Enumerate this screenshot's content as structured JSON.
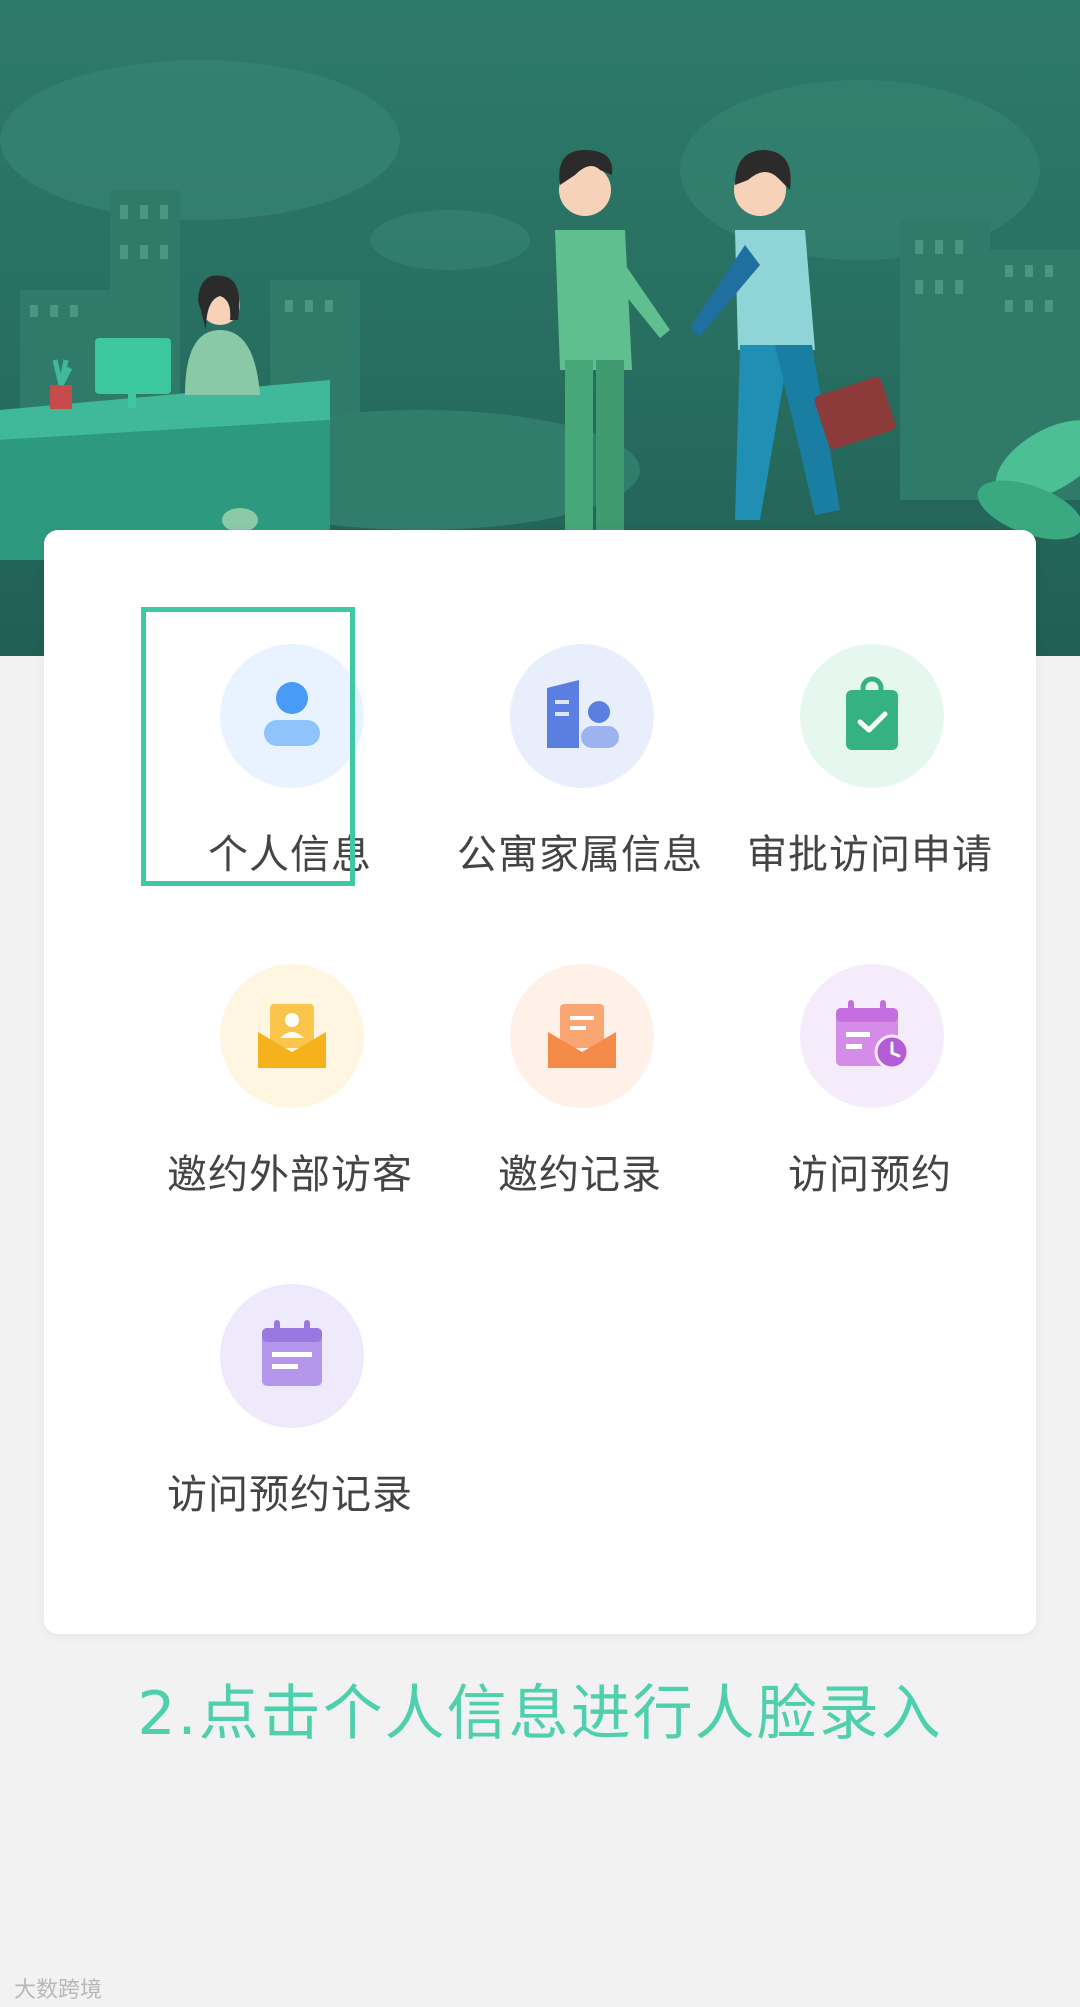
{
  "menu": {
    "items": [
      {
        "label": "个人信息",
        "icon": "person-icon",
        "bg": "#e9f3ff",
        "color": "#4a9bf7"
      },
      {
        "label": "公寓家属信息",
        "icon": "apartment-family-icon",
        "bg": "#e8eefc",
        "color": "#5b7fe0"
      },
      {
        "label": "审批访问申请",
        "icon": "clipboard-check-icon",
        "bg": "#e6f7f0",
        "color": "#35b27f"
      },
      {
        "label": "邀约外部访客",
        "icon": "invite-visitor-icon",
        "bg": "#fff6e2",
        "color": "#f6b21d"
      },
      {
        "label": "邀约记录",
        "icon": "invite-record-icon",
        "bg": "#fff0e8",
        "color": "#f58b48"
      },
      {
        "label": "访问预约",
        "icon": "calendar-clock-icon",
        "bg": "#f5ebfb",
        "color": "#c56ee0"
      },
      {
        "label": "访问预约记录",
        "icon": "calendar-record-icon",
        "bg": "#eee9fb",
        "color": "#9b78e0"
      }
    ]
  },
  "instruction": "2.点击个人信息进行人脸录入",
  "watermark": "大数跨境",
  "colors": {
    "accent": "#3ec9a4",
    "banner": "#276e60"
  }
}
